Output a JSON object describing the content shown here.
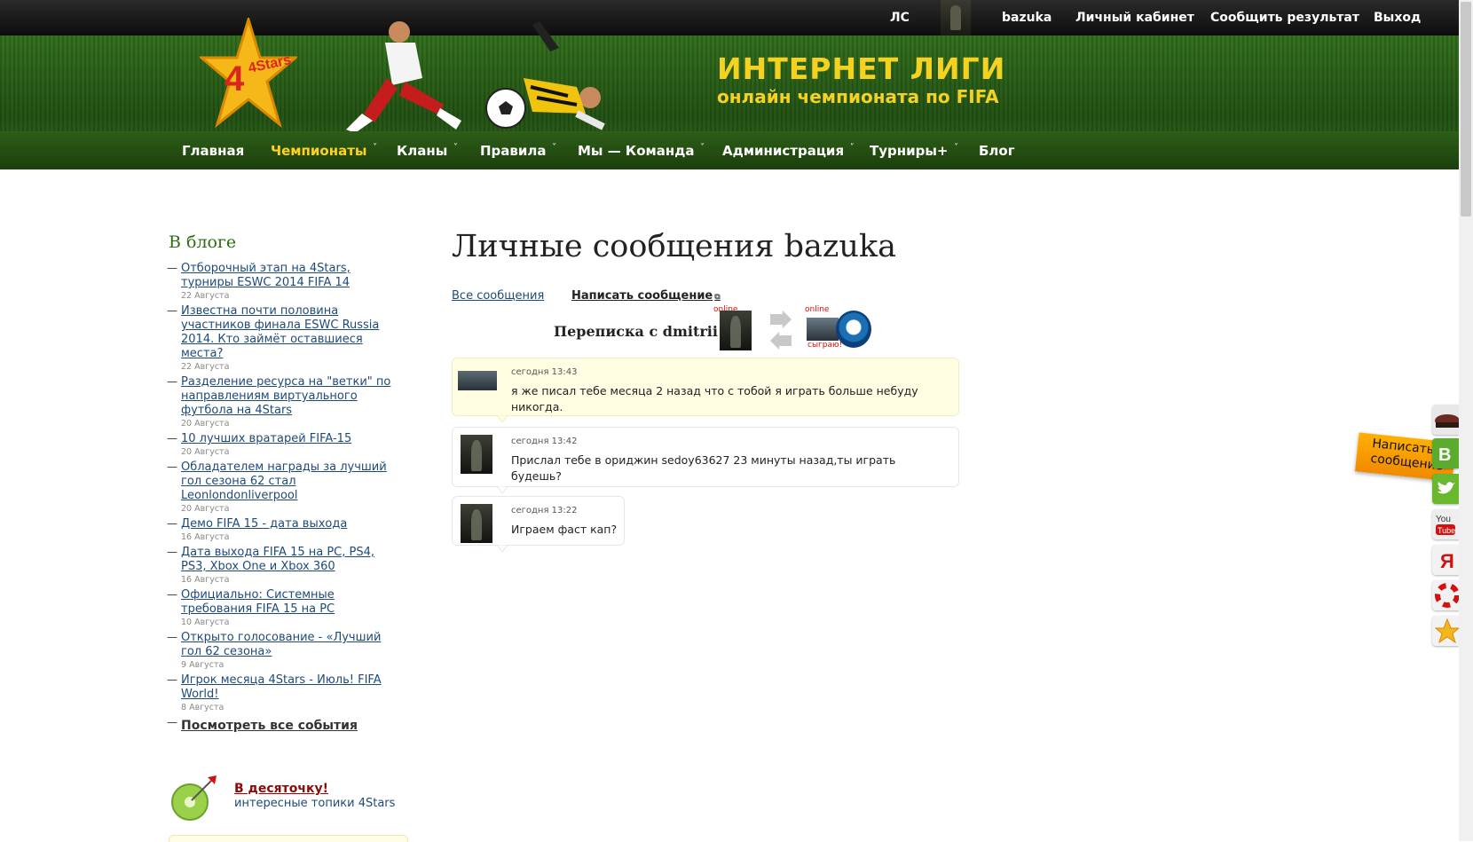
{
  "topbar": {
    "pm": "ЛС",
    "username": "bazuka",
    "cabinet": "Личный кабинет",
    "report": "Сообщить результат",
    "logout": "Выход"
  },
  "header": {
    "logo_text": "4Stars",
    "slogan_title": "ИНТЕРНЕТ ЛИГИ",
    "slogan_sub": "онлайн чемпионата по FIFA"
  },
  "nav": {
    "items": [
      {
        "label": "Главная",
        "has_menu": false
      },
      {
        "label": "Чемпионаты",
        "has_menu": true,
        "active": true
      },
      {
        "label": "Кланы",
        "has_menu": true
      },
      {
        "label": "Правила",
        "has_menu": true
      },
      {
        "label": "Мы — Команда",
        "has_menu": true
      },
      {
        "label": "Администрация",
        "has_menu": true
      },
      {
        "label": "Турниры+",
        "has_menu": true
      },
      {
        "label": "Блог",
        "has_menu": false
      }
    ]
  },
  "sidebar": {
    "title": "В блоге",
    "posts": [
      {
        "title": "Отборочный этап на 4Stars, турниры ESWC 2014 FIFA 14",
        "date": "22 Августа"
      },
      {
        "title": "Известна почти половина участников финала ESWC Russia 2014. Кто займёт оставшиеся места?",
        "date": "22 Августа"
      },
      {
        "title": "Разделение ресурса на \"ветки\" по направлениям виртуального футбола на 4Stars",
        "date": "20 Августа"
      },
      {
        "title": "10 лучших вратарей FIFA-15",
        "date": "20 Августа"
      },
      {
        "title": "Обладателем награды за лучший гол сезона 62 стал Leonlondonliverpool",
        "date": "20 Августа"
      },
      {
        "title": "Демо FIFA 15 - дата выхода",
        "date": "16 Августа"
      },
      {
        "title": "Дата выхода FIFA 15 на PC, PS4, PS3, Xbox One и Xbox 360",
        "date": "16 Августа"
      },
      {
        "title": "Официально: Системные требования FIFA 15 на PC",
        "date": "10 Августа"
      },
      {
        "title": "Открыто голосование - «Лучший гол 62 сезона»",
        "date": "9 Августа"
      },
      {
        "title": "Игрок месяца 4Stars - Июль! FIFA World!",
        "date": "8 Августа"
      }
    ],
    "see_all": "Посмотреть все события",
    "promo_title": "В десяточку!",
    "promo_sub": "интересные топики 4Stars"
  },
  "main": {
    "title": "Личные сообщения bazuka",
    "link_all": "Все сообщения",
    "link_write": "Написать сообщение",
    "correspondence": "Переписка с dmitrii",
    "online_label": "online",
    "play_label": "сыграю!"
  },
  "messages": [
    {
      "time": "сегодня 13:43",
      "text": "я же писал тебе месяца 2 назад что с тобой я играть больше небуду никогда.",
      "own": true
    },
    {
      "time": "сегодня 13:42",
      "text": "Прислал тебе в ориджин sedoy63627 23 минуты назад,ты играть будешь?",
      "own": false
    },
    {
      "time": "сегодня 13:22",
      "text": "Играем фаст кап?",
      "own": false
    }
  ],
  "widgets": {
    "write_tab": "Написать сообщение",
    "social": [
      "military-cap-icon",
      "vk-icon",
      "twitter-icon",
      "youtube-icon",
      "yandex-icon",
      "lifebuoy-icon",
      "star-icon"
    ]
  },
  "colors": {
    "nav_active": "#ffd21f",
    "link": "#1e4a7a",
    "online": "#d41111",
    "header_green": "#2f6b1a"
  }
}
